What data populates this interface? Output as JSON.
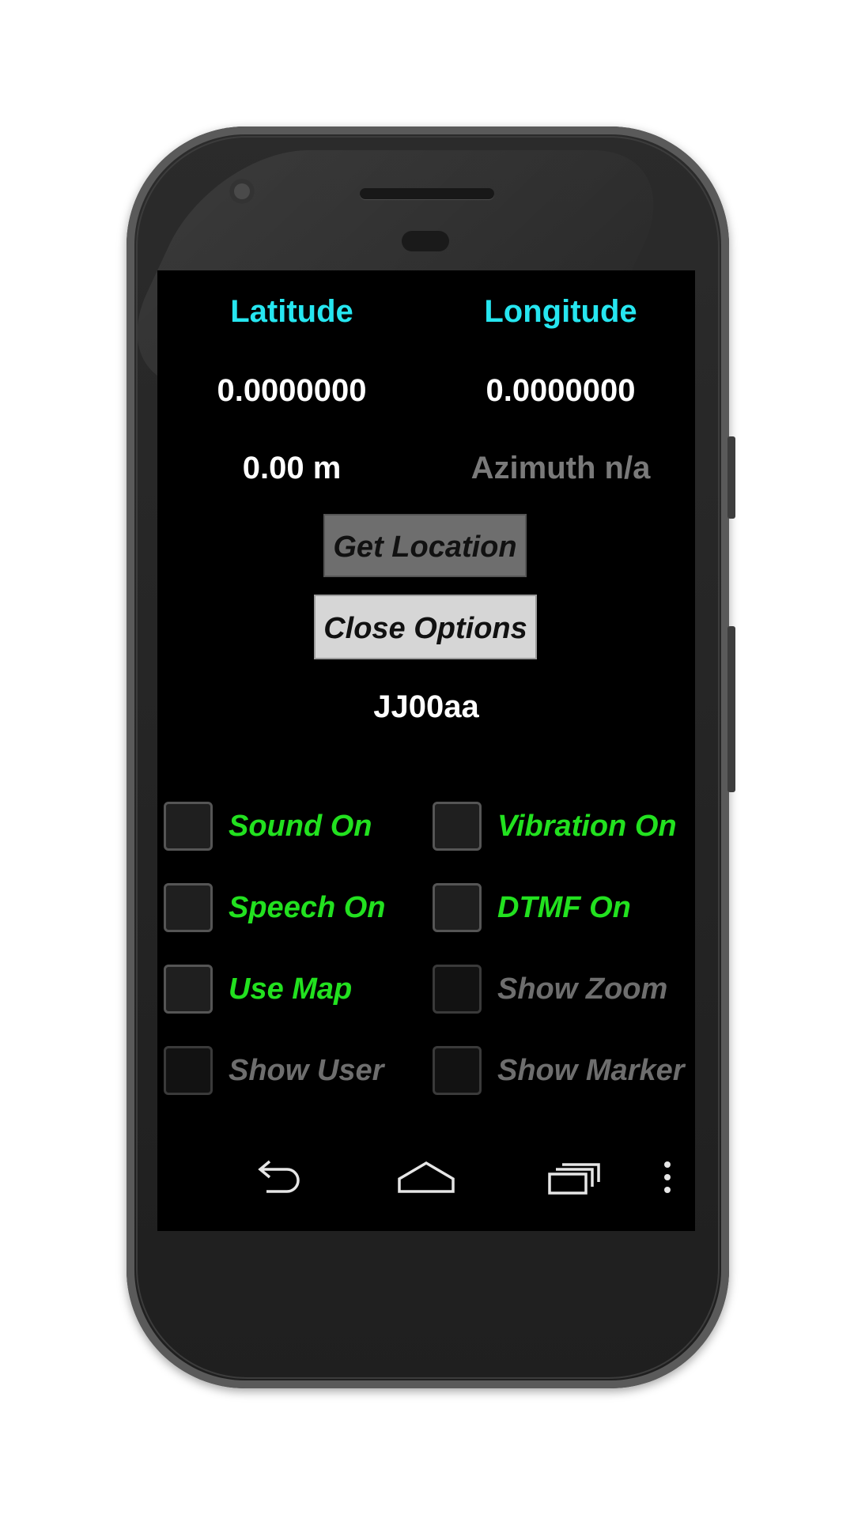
{
  "header": {
    "latitude_label": "Latitude",
    "longitude_label": "Longitude",
    "latitude_value": "0.0000000",
    "longitude_value": "0.0000000",
    "altitude": "0.00 m",
    "azimuth": "Azimuth n/a"
  },
  "buttons": {
    "get_location": "Get Location",
    "close_options": "Close Options"
  },
  "locator": "JJ00aa",
  "options": [
    {
      "label": "Sound On",
      "enabled": true
    },
    {
      "label": "Vibration On",
      "enabled": true
    },
    {
      "label": "Speech On",
      "enabled": true
    },
    {
      "label": "DTMF On",
      "enabled": true
    },
    {
      "label": "Use Map",
      "enabled": true
    },
    {
      "label": "Show Zoom",
      "enabled": false
    },
    {
      "label": "Show User",
      "enabled": false
    },
    {
      "label": "Show Marker",
      "enabled": false
    }
  ],
  "nav": {
    "icons": [
      "back-icon",
      "home-icon",
      "recents-icon",
      "overflow-menu-icon"
    ]
  },
  "colors": {
    "label_cyan": "#26e6f0",
    "option_green": "#22e11f",
    "disabled_gray": "#6e6e6e",
    "screen_bg": "#000000"
  }
}
